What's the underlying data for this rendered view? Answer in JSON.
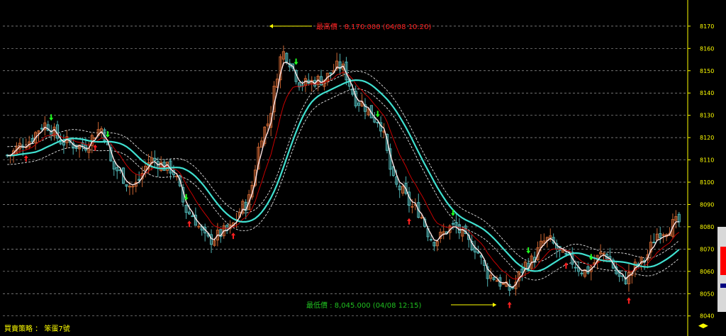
{
  "chart_data": {
    "type": "candlestick",
    "yticks": [
      8040,
      8050,
      8060,
      8070,
      8080,
      8090,
      8100,
      8110,
      8120,
      8130,
      8140,
      8150,
      8160,
      8170
    ],
    "ylim": [
      8038,
      8176
    ],
    "grid": true,
    "annotations": {
      "high": {
        "label": "最高價 : 8,170.000 (04/08 10:20)",
        "value": 8170
      },
      "low": {
        "label": "最低價 : 8,045.000 (04/08 12:15)",
        "value": 8045
      }
    },
    "series_trend": {
      "close_keypoints": [
        [
          0,
          8112
        ],
        [
          6,
          8118
        ],
        [
          12,
          8126
        ],
        [
          18,
          8118
        ],
        [
          24,
          8116
        ],
        [
          30,
          8124
        ],
        [
          34,
          8106
        ],
        [
          40,
          8098
        ],
        [
          46,
          8110
        ],
        [
          52,
          8106
        ],
        [
          58,
          8086
        ],
        [
          64,
          8074
        ],
        [
          70,
          8078
        ],
        [
          76,
          8090
        ],
        [
          82,
          8124
        ],
        [
          88,
          8158
        ],
        [
          94,
          8144
        ],
        [
          100,
          8146
        ],
        [
          106,
          8152
        ],
        [
          112,
          8136
        ],
        [
          118,
          8128
        ],
        [
          124,
          8098
        ],
        [
          130,
          8088
        ],
        [
          136,
          8074
        ],
        [
          142,
          8080
        ],
        [
          148,
          8072
        ],
        [
          154,
          8058
        ],
        [
          160,
          8052
        ],
        [
          166,
          8064
        ],
        [
          172,
          8074
        ],
        [
          178,
          8066
        ],
        [
          184,
          8060
        ],
        [
          190,
          8068
        ],
        [
          196,
          8056
        ],
        [
          202,
          8064
        ],
        [
          208,
          8078
        ],
        [
          214,
          8082
        ]
      ],
      "signals_buy_bar": [
        6,
        28,
        58,
        72,
        128,
        160,
        178,
        198
      ],
      "signals_sell_bar": [
        14,
        32,
        57,
        92,
        118,
        142,
        166,
        186
      ]
    },
    "colors": {
      "background": "#000000",
      "bull_candle": "#c86432",
      "bear_candle": "#50b4b4",
      "ma_fast": "#ffe6e6",
      "ma_mid": "#c80000",
      "ma_slow": "#40e0d0",
      "band": "#ffffff",
      "buy_arrow": "#ff2020",
      "sell_arrow": "#20ff20",
      "high_annotation": "#ff2020",
      "low_annotation": "#20c020",
      "arrow_line": "#ffff00",
      "axis_text": "#ffff00",
      "grid": "#9a9a9a"
    }
  },
  "footer": {
    "label": "買賣策略 ： 笨蛋7號",
    "pager": "◀▶"
  }
}
